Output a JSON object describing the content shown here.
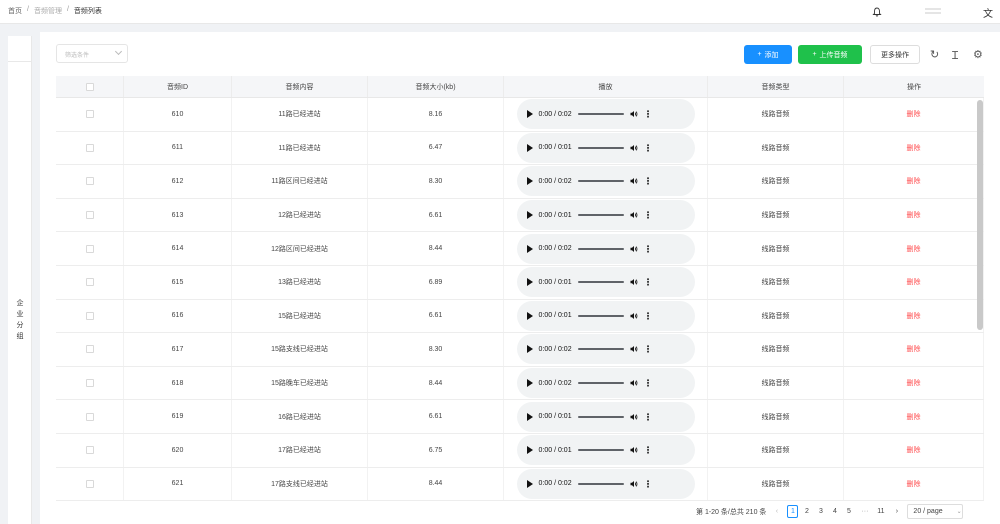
{
  "breadcrumb": {
    "home": "首页",
    "section": "音频管理",
    "current": "音频列表",
    "separator": "/"
  },
  "filter": {
    "placeholder": "筛选条件"
  },
  "toolbar": {
    "add_label": "添加",
    "upload_label": "上传音频",
    "more_label": "更多操作"
  },
  "sidebar": {
    "group_label": "企业分组"
  },
  "table": {
    "columns": [
      "音频ID",
      "音频内容",
      "音频大小(kb)",
      "播放",
      "音频类型",
      "操作"
    ],
    "rows": [
      {
        "id": "610",
        "content": "11路已经进站",
        "size": "8.16",
        "time": "0:00 / 0:02",
        "type": "线路音频",
        "action": "删除"
      },
      {
        "id": "611",
        "content": "11路已经进站",
        "size": "6.47",
        "time": "0:00 / 0:01",
        "type": "线路音频",
        "action": "删除"
      },
      {
        "id": "612",
        "content": "11路区间已经进站",
        "size": "8.30",
        "time": "0:00 / 0:02",
        "type": "线路音频",
        "action": "删除"
      },
      {
        "id": "613",
        "content": "12路已经进站",
        "size": "6.61",
        "time": "0:00 / 0:01",
        "type": "线路音频",
        "action": "删除"
      },
      {
        "id": "614",
        "content": "12路区间已经进站",
        "size": "8.44",
        "time": "0:00 / 0:02",
        "type": "线路音频",
        "action": "删除"
      },
      {
        "id": "615",
        "content": "13路已经进站",
        "size": "6.89",
        "time": "0:00 / 0:01",
        "type": "线路音频",
        "action": "删除"
      },
      {
        "id": "616",
        "content": "15路已经进站",
        "size": "6.61",
        "time": "0:00 / 0:01",
        "type": "线路音频",
        "action": "删除"
      },
      {
        "id": "617",
        "content": "15路支线已经进站",
        "size": "8.30",
        "time": "0:00 / 0:02",
        "type": "线路音频",
        "action": "删除"
      },
      {
        "id": "618",
        "content": "15路晚车已经进站",
        "size": "8.44",
        "time": "0:00 / 0:02",
        "type": "线路音频",
        "action": "删除"
      },
      {
        "id": "619",
        "content": "16路已经进站",
        "size": "6.61",
        "time": "0:00 / 0:01",
        "type": "线路音频",
        "action": "删除"
      },
      {
        "id": "620",
        "content": "17路已经进站",
        "size": "6.75",
        "time": "0:00 / 0:01",
        "type": "线路音频",
        "action": "删除"
      },
      {
        "id": "621",
        "content": "17路支线已经进站",
        "size": "8.44",
        "time": "0:00 / 0:02",
        "type": "线路音频",
        "action": "删除"
      }
    ]
  },
  "pagination": {
    "summary": "第 1-20 条/总共 210 条",
    "prev": "‹",
    "pages": [
      "1",
      "2",
      "3",
      "4",
      "5"
    ],
    "ellipsis": "···",
    "last": "11",
    "next": "›",
    "page_size": "20 / page",
    "active_page": "1"
  },
  "colors": {
    "primary": "#1890ff",
    "success": "#1fc14b",
    "danger": "#ff4d4f"
  },
  "icons": {
    "bell": "bell-icon",
    "translate": "translate-icon",
    "refresh": "refresh-icon",
    "column_height": "column-height-icon",
    "settings": "settings-icon"
  }
}
